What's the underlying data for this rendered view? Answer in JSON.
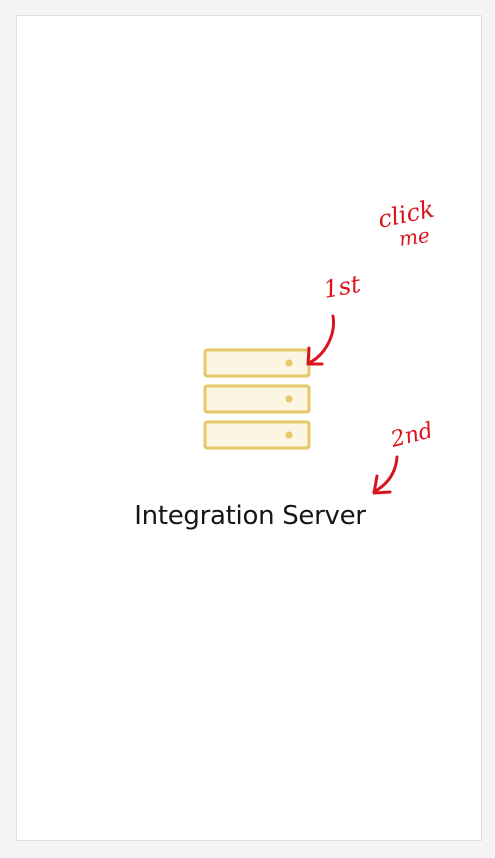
{
  "tile": {
    "title": "Integration Server",
    "icon": "server-rack-icon"
  },
  "annotations": {
    "click_me_line1": "click",
    "click_me_line2": "me",
    "first": "1st",
    "second": "2nd"
  },
  "colors": {
    "icon_stroke": "#e5c76a",
    "icon_fill": "#fcf5e1",
    "icon_dot": "#e5c76a",
    "annotation_red": "#d9141e",
    "title_text": "#161616"
  }
}
